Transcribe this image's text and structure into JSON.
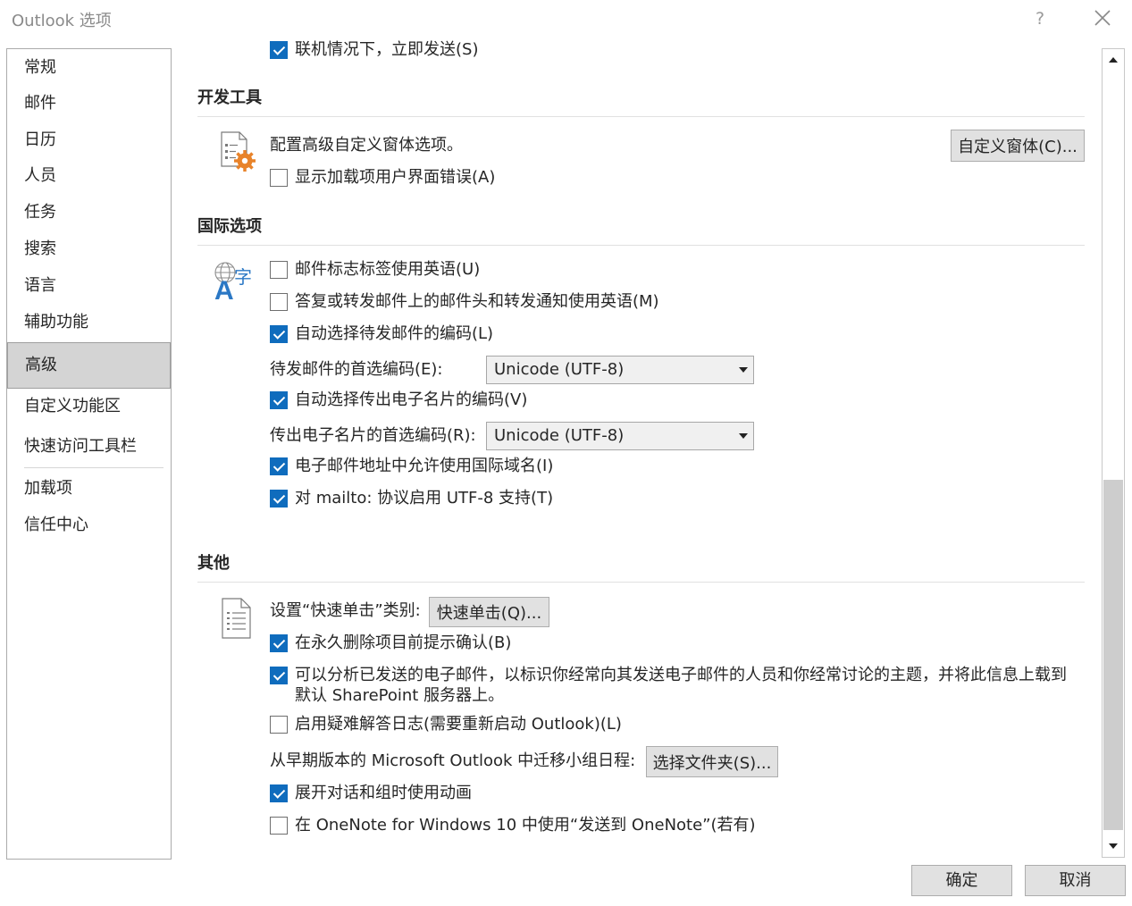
{
  "window": {
    "title": "Outlook 选项",
    "help": "?"
  },
  "sidebar": {
    "items": [
      {
        "label": "常规"
      },
      {
        "label": "邮件"
      },
      {
        "label": "日历"
      },
      {
        "label": "人员"
      },
      {
        "label": "任务"
      },
      {
        "label": "搜索"
      },
      {
        "label": "语言"
      },
      {
        "label": "辅助功能"
      },
      {
        "label": "高级",
        "active": true
      },
      {
        "label": "自定义功能区"
      },
      {
        "label": "快速访问工具栏"
      },
      {
        "label": "加载项"
      },
      {
        "label": "信任中心"
      }
    ]
  },
  "partial_top": {
    "label": "联机情况下，立即发送(S)",
    "checked": true
  },
  "dev": {
    "title": "开发工具",
    "desc": "配置高级自定义窗体选项。",
    "custom_forms_button": "自定义窗体(C)...",
    "show_addin_errors": {
      "label": "显示加载项用户界面错误(A)",
      "checked": false
    }
  },
  "intl": {
    "title": "国际选项",
    "flag_english": {
      "label": "邮件标志标签使用英语(U)",
      "checked": false
    },
    "reply_english": {
      "label": "答复或转发邮件上的邮件头和转发通知使用英语(M)",
      "checked": false
    },
    "auto_encoding": {
      "label": "自动选择待发邮件的编码(L)",
      "checked": true
    },
    "preferred_outgoing_label": "待发邮件的首选编码(E):",
    "preferred_outgoing_value": "Unicode (UTF-8)",
    "auto_vcard": {
      "label": "自动选择传出电子名片的编码(V)",
      "checked": true
    },
    "preferred_vcard_label": "传出电子名片的首选编码(R):",
    "preferred_vcard_value": "Unicode (UTF-8)",
    "intl_domain": {
      "label": "电子邮件地址中允许使用国际域名(I)",
      "checked": true
    },
    "mailto_utf8": {
      "label": "对 mailto: 协议启用 UTF-8 支持(T)",
      "checked": true
    }
  },
  "other": {
    "title": "其他",
    "quick_click_label": "设置“快速单击”类别:",
    "quick_click_button": "快速单击(Q)...",
    "confirm_delete": {
      "label": "在永久删除项目前提示确认(B)",
      "checked": true
    },
    "analyze_mail": {
      "label": "可以分析已发送的电子邮件，以标识你经常向其发送电子邮件的人员和你经常讨论的主题，并将此信息上载到默认 SharePoint 服务器上。",
      "checked": true
    },
    "troubleshoot_log": {
      "label": "启用疑难解答日志(需要重新启动 Outlook)(L)",
      "checked": false
    },
    "migrate_label": "从早期版本的 Microsoft Outlook 中迁移小组日程:",
    "select_folder_button": "选择文件夹(S)...",
    "animations": {
      "label": "展开对话和组时使用动画",
      "checked": true
    },
    "onenote": {
      "label": "在 OneNote for Windows 10 中使用“发送到 OneNote”(若有)",
      "checked": false
    }
  },
  "footer": {
    "ok": "确定",
    "cancel": "取消"
  },
  "colors": {
    "accent": "#0f6cbd",
    "gear": "#e8832a",
    "intl_icon": "#2b78c5"
  }
}
